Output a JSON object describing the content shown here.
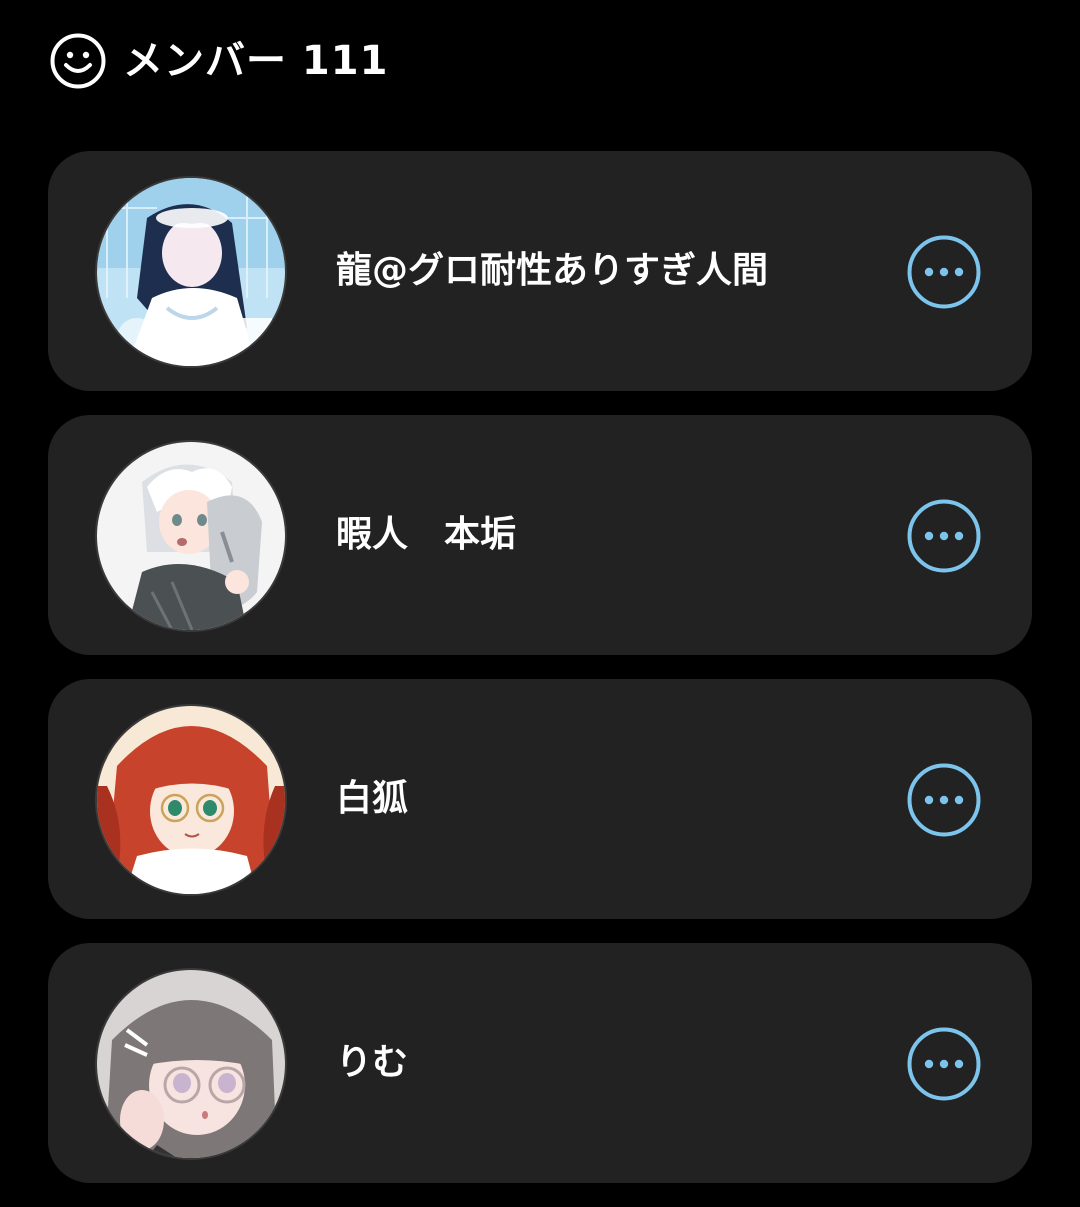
{
  "header": {
    "title": "メンバー 111",
    "icon": "smiley-face-icon"
  },
  "accent_color": "#7cc4ec",
  "members": [
    {
      "name": "龍@グロ耐性ありすぎ人間",
      "avatar": "blue-anime-girl-avatar",
      "menu_icon": "more-options-icon"
    },
    {
      "name": "暇人　本垢",
      "avatar": "silver-hair-anime-avatar",
      "menu_icon": "more-options-icon"
    },
    {
      "name": "白狐",
      "avatar": "red-hair-glasses-avatar",
      "menu_icon": "more-options-icon"
    },
    {
      "name": "りむ",
      "avatar": "grey-hair-glasses-avatar",
      "menu_icon": "more-options-icon"
    }
  ]
}
